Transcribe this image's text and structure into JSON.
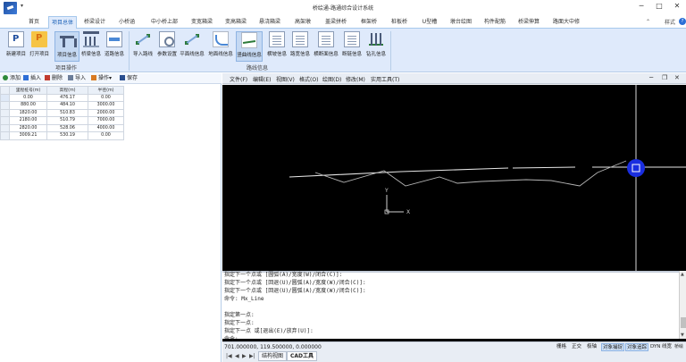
{
  "titlebar": {
    "title": "桥绘通-路通综合设计系统",
    "quick_access_arrow": "▾",
    "minimize": "─",
    "maximize": "□",
    "close": "✕"
  },
  "tabs": [
    "首页",
    "项目总体",
    "桥梁设计",
    "小桥涵",
    "中小桥上部",
    "变宽箱梁",
    "变高箱梁",
    "悬浇箱梁",
    "高架墩",
    "盖梁拼桥",
    "框架桥",
    "桩板桥",
    "U型槽",
    "墩台绘图",
    "构件配筋",
    "桥梁伸算",
    "路面大中修"
  ],
  "active_tab": "项目总体",
  "style_label": "样式",
  "caret_up": "⌃",
  "help": "?",
  "ribbon": {
    "buttons": [
      {
        "label": "新建项目",
        "icon": "new-project-icon"
      },
      {
        "label": "打开项目",
        "icon": "open-project-icon"
      },
      {
        "label": "项目信息",
        "icon": "project-info-icon"
      },
      {
        "label": "桥梁信息",
        "icon": "bridge-info-icon"
      },
      {
        "label": "道路信息",
        "icon": "road-info-icon"
      },
      {
        "label": "导入路线",
        "icon": "import-route-icon"
      },
      {
        "label": "参数设置",
        "icon": "params-icon"
      },
      {
        "label": "平面线信息",
        "icon": "plane-line-icon"
      },
      {
        "label": "地面线信息",
        "icon": "ground-line-icon"
      },
      {
        "label": "竖曲线信息",
        "icon": "vertical-curve-icon"
      },
      {
        "label": "横坡信息",
        "icon": "cross-slope-icon"
      },
      {
        "label": "路宽信息",
        "icon": "road-width-icon"
      },
      {
        "label": "横断面信息",
        "icon": "cross-section-icon"
      },
      {
        "label": "断链信息",
        "icon": "chain-break-icon"
      },
      {
        "label": "钻孔信息",
        "icon": "borehole-icon"
      }
    ],
    "selected": [
      "项目信息",
      "竖曲线信息"
    ],
    "groups": [
      "项目操作",
      "路线信息"
    ]
  },
  "left_toolbar": {
    "add": "添加",
    "insert": "插入",
    "delete": "删除",
    "import": "导入",
    "operate": "操作",
    "operate_arrow": "▾",
    "save": "保存"
  },
  "table": {
    "columns": [
      "里程桩号(m)",
      "高程(m)",
      "半径(m)"
    ],
    "rows": [
      [
        "0.00",
        "476.17",
        "0.00"
      ],
      [
        "880.00",
        "484.10",
        "3000.00"
      ],
      [
        "1820.00",
        "510.83",
        "2000.00"
      ],
      [
        "2180.00",
        "510.79",
        "7000.00"
      ],
      [
        "2820.00",
        "528.06",
        "4000.00"
      ],
      [
        "3009.21",
        "530.19",
        "0.00"
      ]
    ]
  },
  "cad_menu": [
    "文件(F)",
    "编辑(E)",
    "视图(V)",
    "格式(O)",
    "绘图(D)",
    "修改(M)",
    "实用工具(T)"
  ],
  "cad_window_controls": {
    "minimize": "─",
    "restore": "❐",
    "close": "✕"
  },
  "canvas": {
    "axis_y": "Y",
    "axis_x": "X",
    "colors": {
      "background": "#000000",
      "lines": "#d9d9d9",
      "marker": "#1a2ee0",
      "axis": "#cfcfcf"
    }
  },
  "command_lines": [
    "指定下一个点或 [圆弧(A)/宽度(W)/闭合(C)]:",
    "指定下一个点或 [回退(U)/圆弧(A)/宽度(W)/闭合(C)]:",
    "指定下一个点或 [回退(U)/圆弧(A)/宽度(W)/闭合(C)]:",
    "命令: Mx_Line",
    "",
    "指定第一点:",
    "指定下一点:",
    "指定下一点 或[退出(E)/放弃(U)]:",
    "命令:"
  ],
  "status": {
    "coords": "701.000000, 119.500000, 0.000000",
    "toggles": [
      {
        "label": "栅格",
        "on": false
      },
      {
        "label": "正交",
        "on": false
      },
      {
        "label": "极轴",
        "on": false
      },
      {
        "label": "对象捕捉",
        "on": true
      },
      {
        "label": "对象追踪",
        "on": true
      },
      {
        "label": "DYN",
        "on": false
      },
      {
        "label": "线宽",
        "on": false
      },
      {
        "label": "桥绘通",
        "on": false
      }
    ]
  },
  "doc_tabs": {
    "nav": [
      "|◀",
      "◀",
      "▶",
      "▶|"
    ],
    "tabs": [
      "结构视图",
      "CAD工具"
    ],
    "active": "CAD工具"
  }
}
